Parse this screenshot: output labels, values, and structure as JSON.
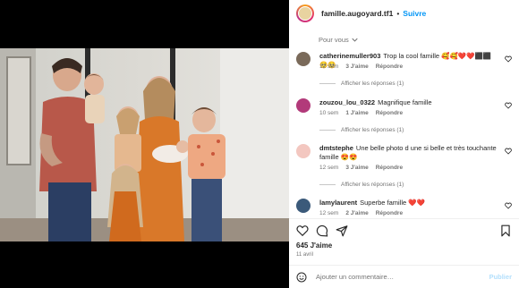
{
  "header": {
    "username": "famille.augoyard.tf1",
    "separator": "•",
    "follow": "Suivre"
  },
  "filter": {
    "label": "Pour vous"
  },
  "comments": [
    {
      "user": "catherinemuller903",
      "text": "Trop la cool famille 🥰🥰❤️❤️⬛⬛🥺🥺",
      "time": "12 sem",
      "likes": "3 J'aime",
      "reply": "Répondre",
      "replies": "Afficher les réponses (1)",
      "avatar_color": "#7a6a5a"
    },
    {
      "user": "zouzou_lou_0322",
      "text": "Magnifique famille",
      "time": "10 sem",
      "likes": "1 J'aime",
      "reply": "Répondre",
      "replies": "Afficher les réponses (1)",
      "avatar_color": "#b23a7a"
    },
    {
      "user": "dmtstephe",
      "text": "Une belle photo d une si belle et très touchante famille 😍😍",
      "time": "12 sem",
      "likes": "3 J'aime",
      "reply": "Répondre",
      "replies": "Afficher les réponses (1)",
      "avatar_color": "#f3c7c0"
    },
    {
      "user": "lamylaurent",
      "text": "Superbe famille ❤️❤️",
      "time": "12 sem",
      "likes": "2 J'aime",
      "reply": "Répondre",
      "replies": "",
      "avatar_color": "#3b5a7a"
    }
  ],
  "post": {
    "likes": "645 J'aime",
    "date": "11 avril"
  },
  "add_comment": {
    "placeholder": "Ajouter un commentaire…",
    "publish": "Publier"
  },
  "colors": {
    "accent": "#0095f6",
    "muted": "#737373"
  }
}
